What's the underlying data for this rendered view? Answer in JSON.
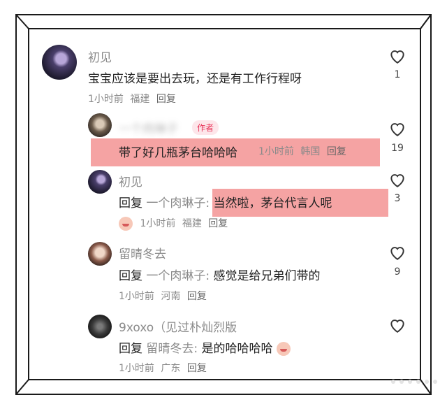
{
  "comments": [
    {
      "name": "初见",
      "text": "宝宝应该是要出去玩，还是有工作行程呀",
      "time": "1小时前",
      "location": "福建",
      "reply_label": "回复",
      "likes": "1"
    },
    {
      "name": "一个肉琳子",
      "author_badge": "作者",
      "text": "带了好几瓶茅台哈哈哈",
      "time": "1小时前",
      "location": "韩国",
      "reply_label": "回复",
      "likes": "19"
    },
    {
      "name": "初见",
      "prefix": "回复",
      "mention": "一个肉琳子:",
      "text": "当然啦，茅台代言人呢",
      "time": "1小时前",
      "location": "福建",
      "reply_label": "回复",
      "likes": "3"
    },
    {
      "name": "留晴冬去",
      "prefix": "回复",
      "mention": "一个肉琳子:",
      "text": "感觉是给兄弟们带的",
      "time": "1小时前",
      "location": "河南",
      "reply_label": "回复",
      "likes": "9"
    },
    {
      "name": "9xoxo（见过朴灿烈版",
      "prefix": "回复",
      "mention": "留晴冬去:",
      "text": "是的哈哈哈哈",
      "time": "1小时前",
      "location": "广东",
      "reply_label": "回复",
      "likes": ""
    }
  ],
  "colors": {
    "highlight": "#f39393",
    "author_badge": "#e8355a",
    "frame": "#1a1a1a"
  }
}
